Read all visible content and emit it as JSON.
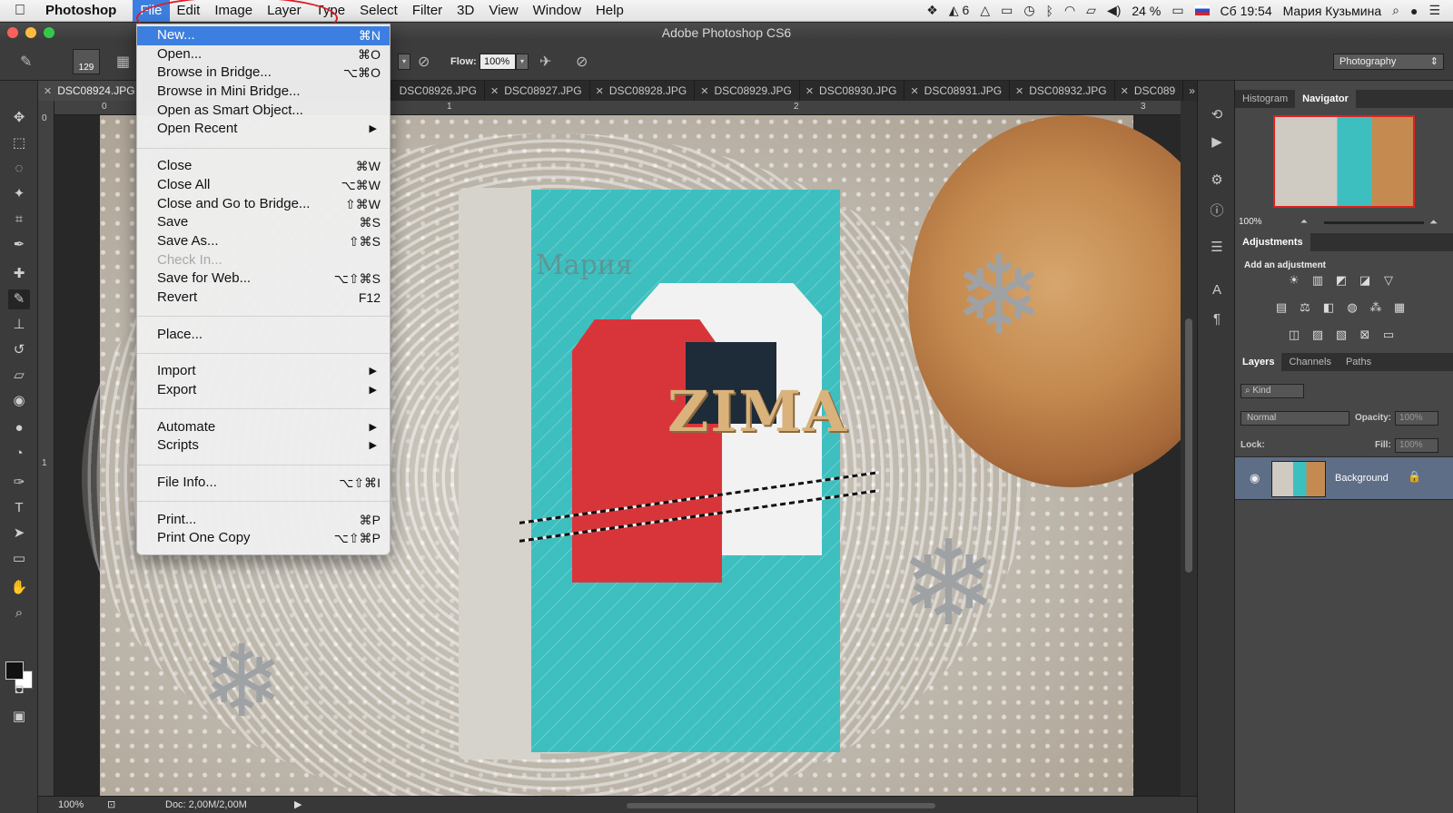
{
  "menubar": {
    "app_name": "Photoshop",
    "menus": [
      "File",
      "Edit",
      "Image",
      "Layer",
      "Type",
      "Select",
      "Filter",
      "3D",
      "View",
      "Window",
      "Help"
    ],
    "status_badge": "6",
    "battery": "24 %",
    "clock": "Сб 19:54",
    "user": "Мария Кузьмина"
  },
  "window": {
    "title": "Adobe Photoshop CS6"
  },
  "options": {
    "brush_size": "129",
    "flow_label": "Flow:",
    "flow_value": "100%",
    "workspace": "Photography"
  },
  "tabs": [
    "DSC08924.JPG",
    "DSC08926.JPG",
    "DSC08927.JPG",
    "DSC08928.JPG",
    "DSC08929.JPG",
    "DSC08930.JPG",
    "DSC08931.JPG",
    "DSC08932.JPG",
    "DSC089"
  ],
  "rulers": {
    "h": [
      "0",
      "1",
      "2",
      "3"
    ],
    "v": [
      "0",
      "1"
    ]
  },
  "canvas": {
    "artwork_text": "ZIMA",
    "watermark": "Мария"
  },
  "status": {
    "zoom": "100%",
    "doc": "Doc: 2,00M/2,00M"
  },
  "file_menu": {
    "items": [
      {
        "label": "New...",
        "shortcut": "⌘N",
        "highlighted": true
      },
      {
        "label": "Open...",
        "shortcut": "⌘O"
      },
      {
        "label": "Browse in Bridge...",
        "shortcut": "⌥⌘O"
      },
      {
        "label": "Browse in Mini Bridge...",
        "shortcut": ""
      },
      {
        "label": "Open as Smart Object...",
        "shortcut": ""
      },
      {
        "label": "Open Recent",
        "shortcut": "",
        "submenu": true
      },
      {
        "separator": true
      },
      {
        "label": "Close",
        "shortcut": "⌘W"
      },
      {
        "label": "Close All",
        "shortcut": "⌥⌘W"
      },
      {
        "label": "Close and Go to Bridge...",
        "shortcut": "⇧⌘W"
      },
      {
        "label": "Save",
        "shortcut": "⌘S"
      },
      {
        "label": "Save As...",
        "shortcut": "⇧⌘S"
      },
      {
        "label": "Check In...",
        "shortcut": "",
        "disabled": true
      },
      {
        "label": "Save for Web...",
        "shortcut": "⌥⇧⌘S"
      },
      {
        "label": "Revert",
        "shortcut": "F12"
      },
      {
        "separator": true
      },
      {
        "label": "Place...",
        "shortcut": ""
      },
      {
        "separator": true
      },
      {
        "label": "Import",
        "shortcut": "",
        "submenu": true
      },
      {
        "label": "Export",
        "shortcut": "",
        "submenu": true
      },
      {
        "separator": true
      },
      {
        "label": "Automate",
        "shortcut": "",
        "submenu": true
      },
      {
        "label": "Scripts",
        "shortcut": "",
        "submenu": true
      },
      {
        "separator": true
      },
      {
        "label": "File Info...",
        "shortcut": "⌥⇧⌘I"
      },
      {
        "separator": true
      },
      {
        "label": "Print...",
        "shortcut": "⌘P"
      },
      {
        "label": "Print One Copy",
        "shortcut": "⌥⇧⌘P"
      }
    ]
  },
  "panels": {
    "top_tabs": [
      "Histogram",
      "Navigator"
    ],
    "navigator_zoom": "100%",
    "adjustments_tab": "Adjustments",
    "adjustments_title": "Add an adjustment",
    "layer_tabs": [
      "Layers",
      "Channels",
      "Paths"
    ],
    "kind_label": "Kind",
    "blend_mode": "Normal",
    "opacity_label": "Opacity:",
    "opacity_value": "100%",
    "lock_label": "Lock:",
    "fill_label": "Fill:",
    "fill_value": "100%",
    "layer_name": "Background"
  },
  "colors": {
    "menu_highlight": "#3d7fe0",
    "annotation": "#e01b24",
    "selected_layer": "#5e6e86"
  }
}
